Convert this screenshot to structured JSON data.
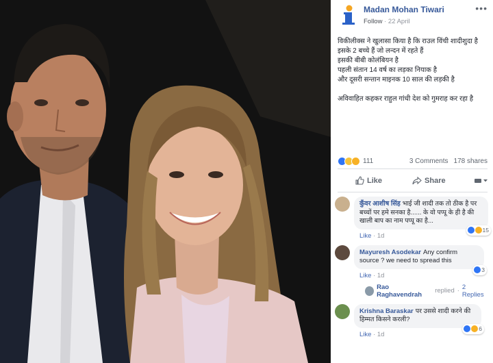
{
  "post": {
    "author": "Madan Mohan Tiwari",
    "follow": "Follow",
    "date": "22 April",
    "menu": "•••",
    "lines": [
      "विकीलीक्स ने खुलासा किया है कि राउल विंची शादीशुदा है",
      "इसके 2 बच्चे हैं जो लन्दन में रहते हैं",
      "इसकी बीबी कोलंबियन है",
      "पहली संतान 14 वर्ष का लड़का नियाक है",
      "और दूसरी सन्तान माइनक 10 साल की लड़की है"
    ],
    "closing": "अविवाहित कहकर राहुल गांधी देश को गुमराह कर रहा है"
  },
  "stats": {
    "reactions": "111",
    "comments": "3 Comments",
    "shares": "178 shares"
  },
  "actions": {
    "like": "Like",
    "share": "Share"
  },
  "comments": [
    {
      "name": "कुँवर आशीष सिंह",
      "text": "भाई जी शादी तक तो ठीक है पर बच्चों पर हमे सनका है...... के वो पप्पू के ही है की खाली बाप का नाम पप्पू का है...",
      "react_count": "15",
      "like": "Like",
      "time": "1d"
    },
    {
      "name": "Mayuresh Asodekar",
      "text": "Any confirm source ? we need to spread this",
      "react_count": "3",
      "like": "Like",
      "time": "1d"
    },
    {
      "name": "Krishna Baraskar",
      "text": "पर उससे शादी करने की हिम्मत किसने करली?",
      "react_count": "6",
      "like": "Like",
      "time": "1d"
    }
  ],
  "reply": {
    "name": "Rao Raghavendrah",
    "text": "replied",
    "sep": "·",
    "count": "2 Replies"
  },
  "colors": {
    "fb_link": "#365899",
    "like_blue": "#2f75f5",
    "bubble": "#f2f3f5"
  }
}
